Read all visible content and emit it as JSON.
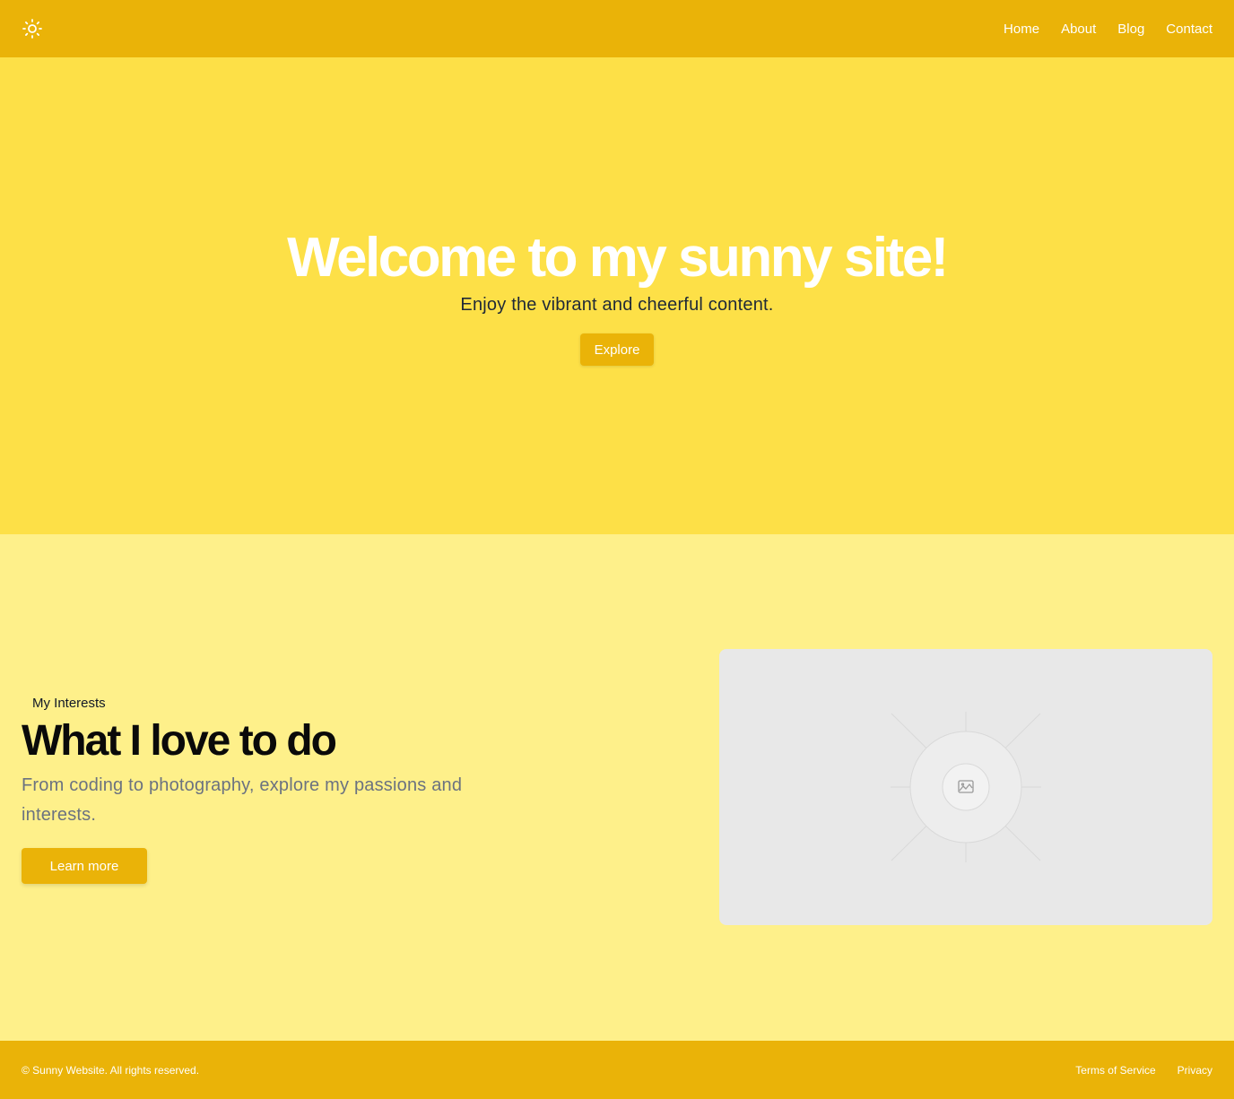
{
  "header": {
    "logo_icon": "sun-icon",
    "nav": [
      {
        "label": "Home"
      },
      {
        "label": "About"
      },
      {
        "label": "Blog"
      },
      {
        "label": "Contact"
      }
    ]
  },
  "hero": {
    "title": "Welcome to my sunny site!",
    "subtitle": "Enjoy the vibrant and cheerful content.",
    "cta_label": "Explore"
  },
  "interests": {
    "tag": "My Interests",
    "title": "What I love to do",
    "description": "From coding to photography, explore my passions and interests.",
    "cta_label": "Learn more",
    "image_icon": "image-placeholder-icon"
  },
  "footer": {
    "copyright": "© Sunny Website. All rights reserved.",
    "links": [
      {
        "label": "Terms of Service"
      },
      {
        "label": "Privacy"
      }
    ]
  },
  "colors": {
    "header_bg": "#eab308",
    "hero_bg": "#fde047",
    "section_bg": "#fef08a",
    "accent": "#eab308"
  }
}
